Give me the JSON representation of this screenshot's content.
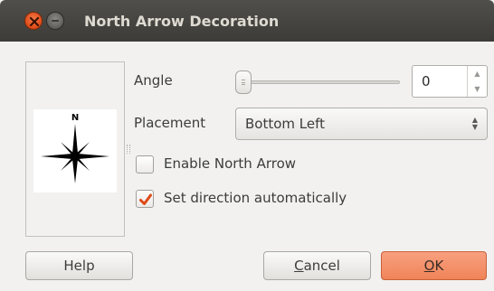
{
  "window": {
    "title": "North Arrow Decoration"
  },
  "preview": {
    "arrow_letter": "N"
  },
  "angle": {
    "label": "Angle",
    "value": "0",
    "slider_fraction": 0
  },
  "placement": {
    "label": "Placement",
    "value": "Bottom Left"
  },
  "options": {
    "enable_label": "Enable North Arrow",
    "enable_checked": false,
    "auto_label": "Set direction automatically",
    "auto_checked": true
  },
  "buttons": {
    "help": "Help",
    "cancel_mnemonic": "C",
    "cancel_rest": "ancel",
    "ok_mnemonic": "O",
    "ok_rest": "K"
  },
  "colors": {
    "titlebar": "#3c3b37",
    "close_button": "#df4a16",
    "ok_button": "#f08459",
    "checkmark": "#df4a16"
  },
  "icons": {
    "close": "close-icon",
    "minimize": "minimize-icon",
    "spin_up": "chevron-up-icon",
    "spin_down": "chevron-down-icon",
    "combo": "updown-arrows-icon",
    "checkmark": "checkmark-icon"
  }
}
